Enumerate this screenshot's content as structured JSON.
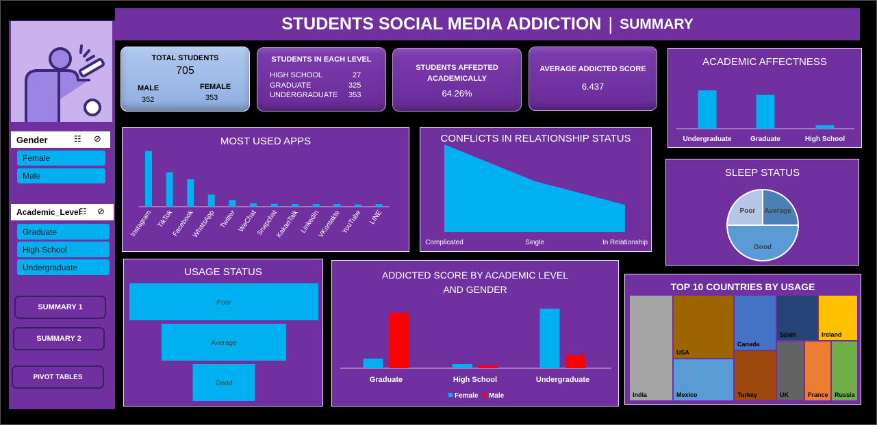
{
  "title": "STUDENTS SOCIAL MEDIA ADDICTION",
  "separator": "|",
  "subtitle": "SUMMARY",
  "slicers": {
    "gender": {
      "label": "Gender",
      "items": [
        "Female",
        "Male"
      ]
    },
    "academic": {
      "label": "Academic_Level",
      "items": [
        "Graduate",
        "High School",
        "Undergraduate"
      ]
    }
  },
  "nav": {
    "summary1": "SUMMARY 1",
    "summary2": "SUMMARY 2",
    "pivot": "PIVOT TABLES"
  },
  "kpis": {
    "total": {
      "label": "TOTAL STUDENTS",
      "value": "705",
      "male_label": "MALE",
      "male_value": "352",
      "female_label": "FEMALE",
      "female_value": "353"
    },
    "levels": {
      "label": "STUDENTS IN EACH LEVEL",
      "rows": [
        {
          "name": "HIGH SCHOOL",
          "value": "27"
        },
        {
          "name": "GRADUATE",
          "value": "325"
        },
        {
          "name": "UNDERGRADUATE",
          "value": "353"
        }
      ]
    },
    "affected": {
      "label": "STUDENTS AFFEDTED ACADEMICALLY",
      "value": "64.26%"
    },
    "avg": {
      "label": "AVERAGE ADDICTED SCORE",
      "value": "6.437"
    }
  },
  "colors": {
    "panel": "#7030a0",
    "bar": "#00b0f0",
    "male": "#ff0000"
  },
  "chart_data": [
    {
      "id": "academic_affectness",
      "type": "bar",
      "title": "ACADEMIC AFFECTNESS",
      "categories": [
        "Undergraduate",
        "Graduate",
        "High School"
      ],
      "values": [
        100,
        88,
        9
      ],
      "ylim": [
        0,
        100
      ]
    },
    {
      "id": "most_used_apps",
      "type": "bar",
      "title": "MOST USED APPS",
      "categories": [
        "Instagram",
        "TikTok",
        "Facebook",
        "WhatsApp",
        "Twitter",
        "WeChat",
        "Snapchat",
        "KakaoTalk",
        "LinkedIn",
        "VKontakte",
        "YouTube",
        "LINE"
      ],
      "values": [
        249,
        154,
        123,
        54,
        30,
        15,
        13,
        12,
        12,
        12,
        10,
        12
      ],
      "ylim": [
        0,
        270
      ]
    },
    {
      "id": "relationship_conflicts",
      "type": "area",
      "title": "CONFLICTS IN RELATIONSHIP STATUS",
      "categories": [
        "Complicated",
        "Single",
        "In Relationship"
      ],
      "values": [
        100,
        58,
        31
      ],
      "ylim": [
        0,
        110
      ]
    },
    {
      "id": "sleep_status",
      "type": "pie",
      "title": "SLEEP STATUS",
      "labels": [
        "Average",
        "Good",
        "Poor"
      ],
      "values": [
        25,
        50,
        25
      ],
      "colors": [
        "#4a7fb8",
        "#5b9bd5",
        "#b4c7e7"
      ]
    },
    {
      "id": "usage_status",
      "type": "bar",
      "title": "USAGE STATUS",
      "categories": [
        "Poor",
        "Average",
        "Good"
      ],
      "values": [
        100,
        66,
        33
      ],
      "ylim": [
        0,
        100
      ]
    },
    {
      "id": "addicted_score",
      "type": "bar",
      "title": "ADDICTED SCORE BY ACADEMIC LEVEL AND GENDER",
      "categories": [
        "Graduate",
        "High School",
        "Undergraduate"
      ],
      "series": [
        {
          "name": "Female",
          "values": [
            14,
            6,
            87
          ]
        },
        {
          "name": "Male",
          "values": [
            81,
            4,
            19
          ]
        }
      ],
      "ylim": [
        0,
        100
      ]
    },
    {
      "id": "top_countries",
      "type": "treemap",
      "title": "TOP 10 COUNTRIES BY USAGE",
      "labels": [
        "India",
        "USA",
        "Mexico",
        "Canada",
        "Turkey",
        "Spain",
        "UK",
        "Ireland",
        "France",
        "Russia"
      ],
      "colors": [
        "#a5a5a5",
        "#9c6500",
        "#5b9bd5",
        "#4472c4",
        "#9e480e",
        "#264478",
        "#636363",
        "#ffc000",
        "#ed7d31",
        "#70ad47"
      ]
    }
  ]
}
